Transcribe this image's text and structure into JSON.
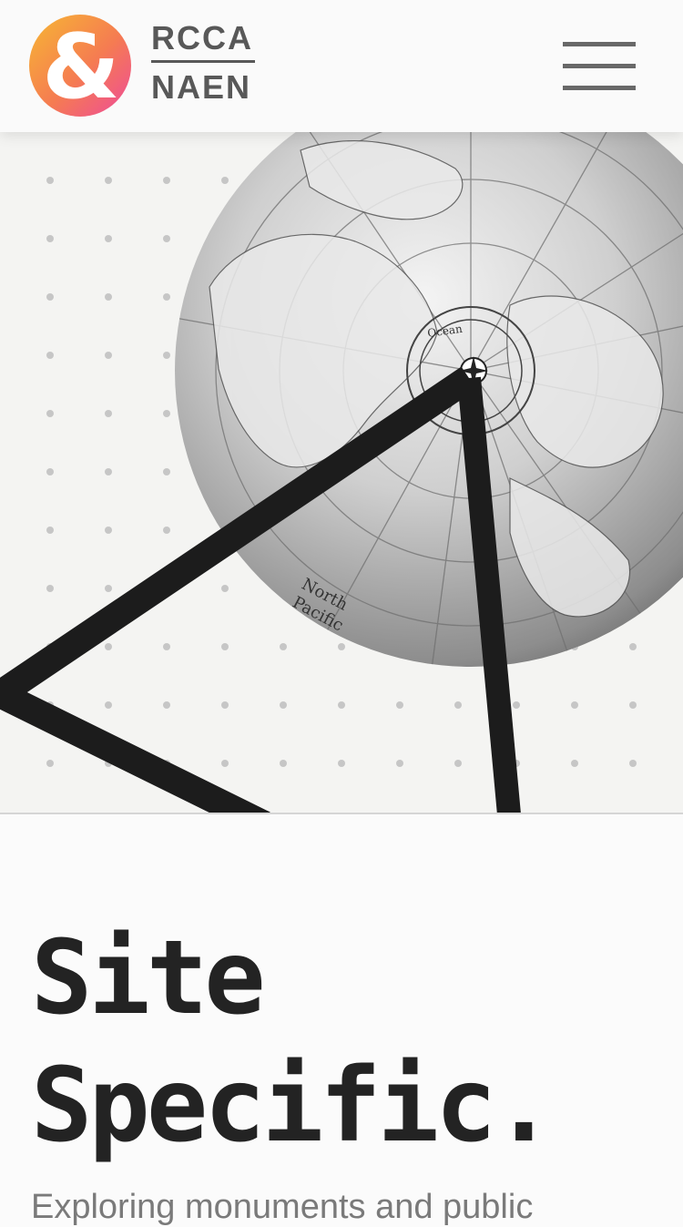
{
  "header": {
    "logo_symbol": "&",
    "logo_top": "RCCA",
    "logo_bottom": "NAEN",
    "logo_gradient": [
      "#f7b733",
      "#ee4a9b"
    ],
    "menu_icon": "hamburger-menu-icon"
  },
  "hero": {
    "globe_label_1": "North",
    "globe_label_2": "Pacific",
    "globe_label_3": "Ocean",
    "colors": {
      "background": "#f4f4f2",
      "dot": "#c6c6c6",
      "triangle": "#1c1c1c"
    }
  },
  "content": {
    "title_line_1": "Site",
    "title_line_2": "Specific.",
    "subtitle": "Exploring monuments and public"
  }
}
